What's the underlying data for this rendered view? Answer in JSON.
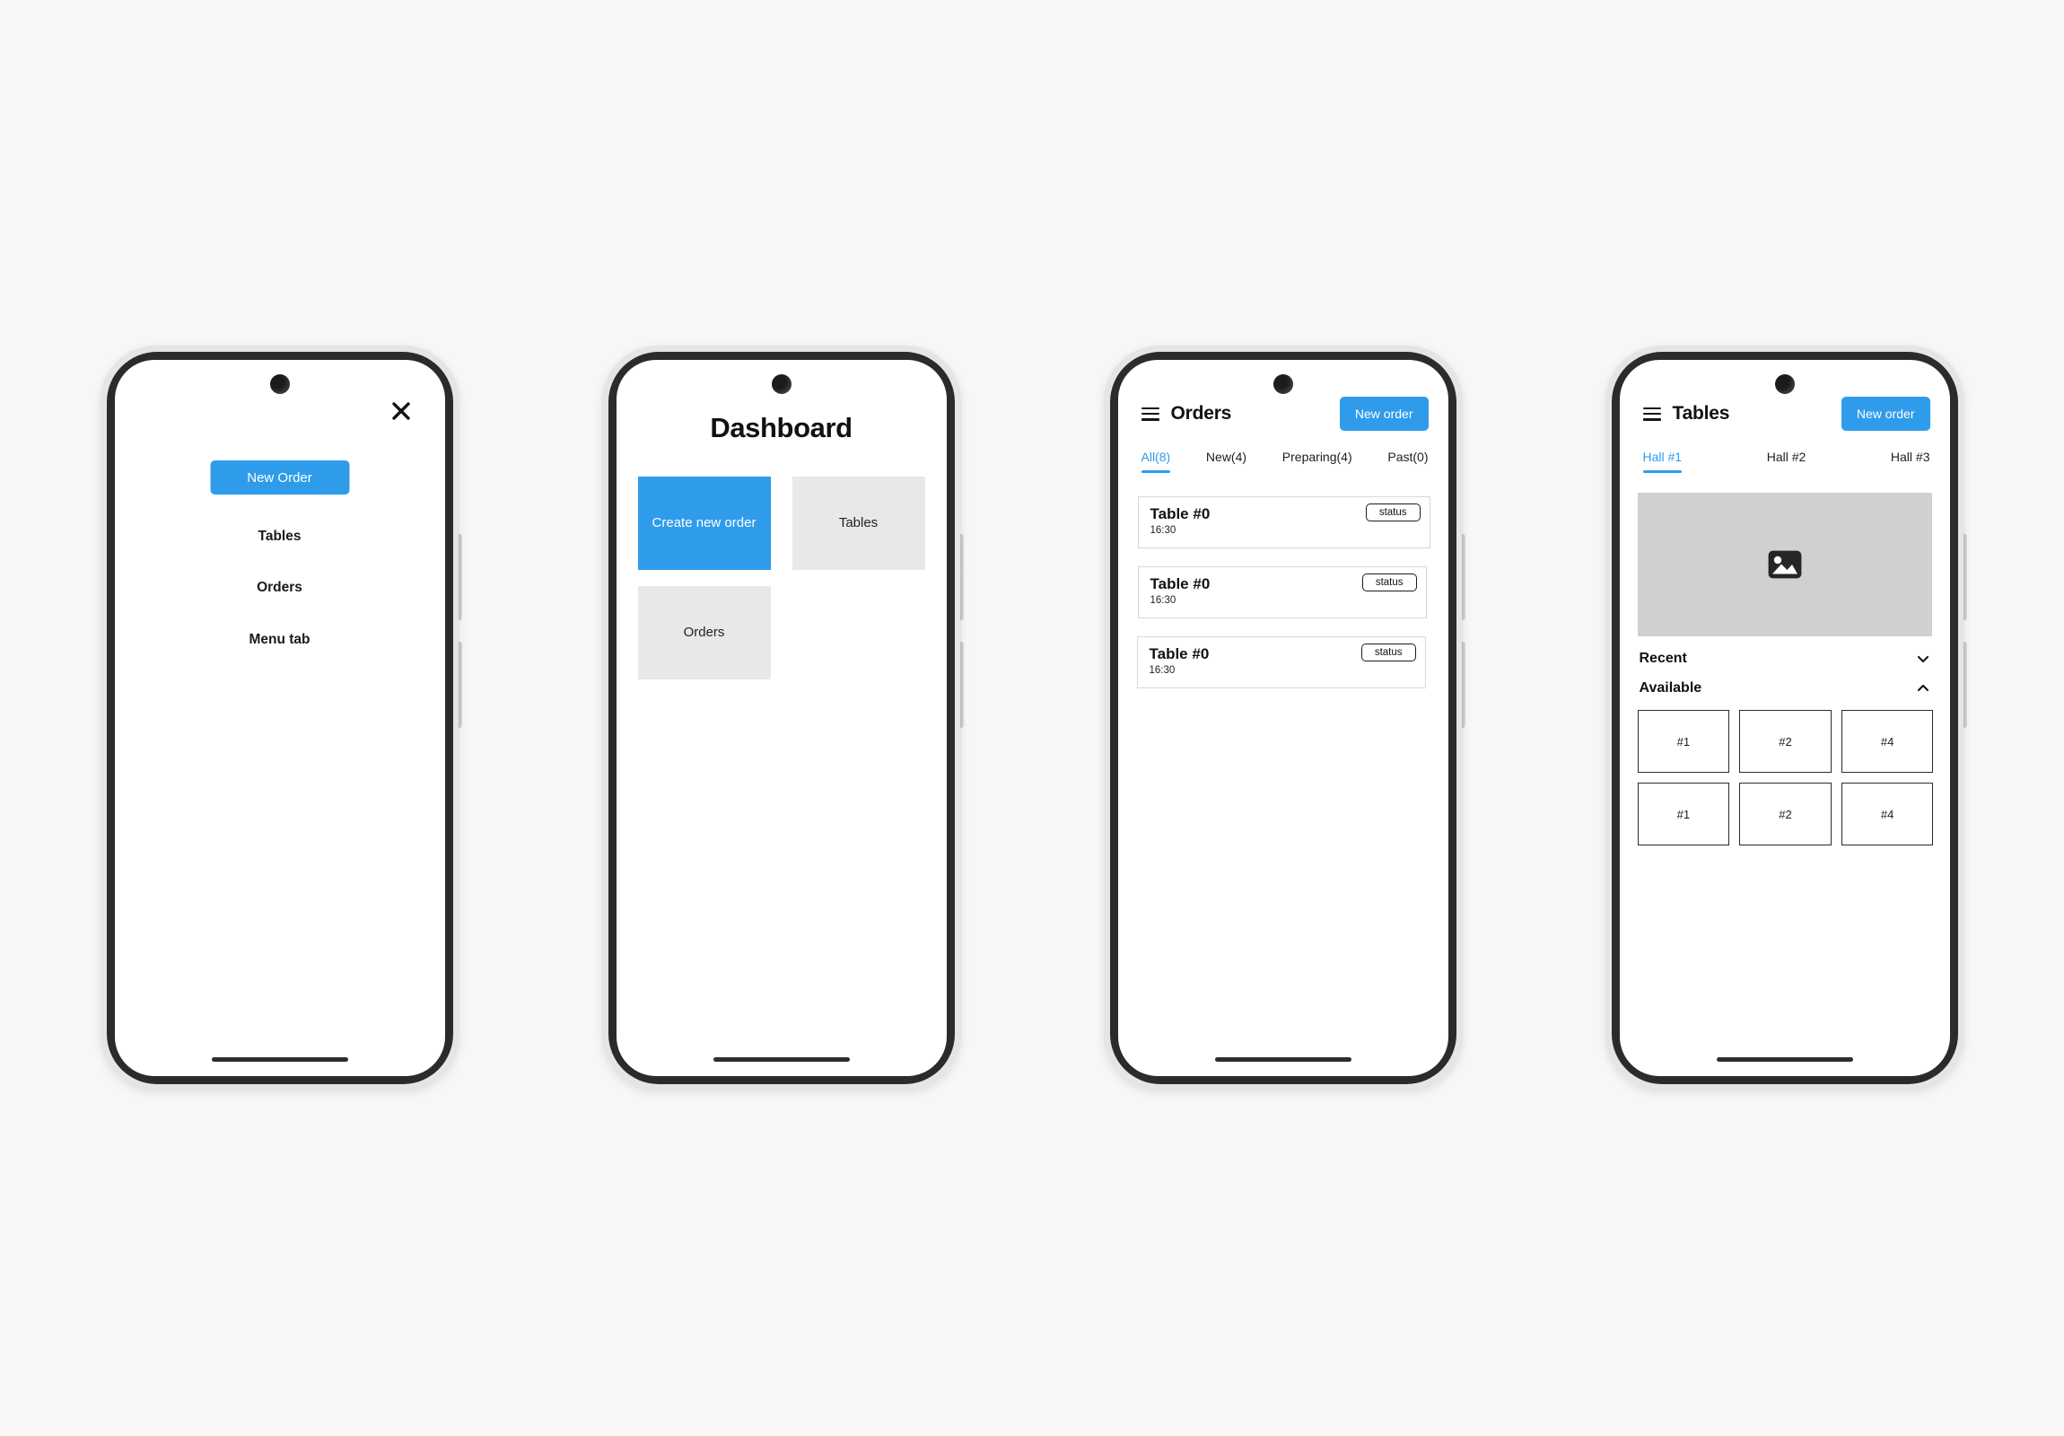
{
  "theme": {
    "accent": "#2f9ceb",
    "background": "#f7f7f7",
    "tile_grey": "#e8e8e8",
    "image_placeholder_grey": "#d0d0d0",
    "text_dark": "#111111"
  },
  "screens": [
    {
      "id": "menu-overlay",
      "close_icon": "close-icon",
      "primary_button": "New Order",
      "links": [
        "Tables",
        "Orders",
        "Menu tab"
      ]
    },
    {
      "id": "dashboard",
      "title": "Dashboard",
      "tiles": [
        {
          "label": "Create new order",
          "variant": "primary"
        },
        {
          "label": "Tables",
          "variant": "grey"
        },
        {
          "label": "Orders",
          "variant": "grey"
        }
      ]
    },
    {
      "id": "orders",
      "menu_icon": "hamburger-icon",
      "title": "Orders",
      "cta": "New order",
      "tabs": [
        {
          "label": "All(8)",
          "active": true
        },
        {
          "label": "New(4)",
          "active": false
        },
        {
          "label": "Preparing(4)",
          "active": false
        },
        {
          "label": "Past(0)",
          "active": false
        }
      ],
      "orders": [
        {
          "title": "Table #0",
          "time": "16:30",
          "status": "status"
        },
        {
          "title": "Table #0",
          "time": "16:30",
          "status": "status"
        },
        {
          "title": "Table #0",
          "time": "16:30",
          "status": "status"
        }
      ]
    },
    {
      "id": "tables",
      "menu_icon": "hamburger-icon",
      "title": "Tables",
      "cta": "New order",
      "tabs": [
        {
          "label": "Hall #1",
          "active": true
        },
        {
          "label": "Hall #2",
          "active": false
        },
        {
          "label": "Hall #3",
          "active": false
        }
      ],
      "hall_image_icon": "image-placeholder-icon",
      "sections": [
        {
          "label": "Recent",
          "expanded": false,
          "chevron": "chevron-down-icon"
        },
        {
          "label": "Available",
          "expanded": true,
          "chevron": "chevron-up-icon"
        }
      ],
      "tables": [
        "#1",
        "#2",
        "#4",
        "#1",
        "#2",
        "#4"
      ]
    }
  ]
}
